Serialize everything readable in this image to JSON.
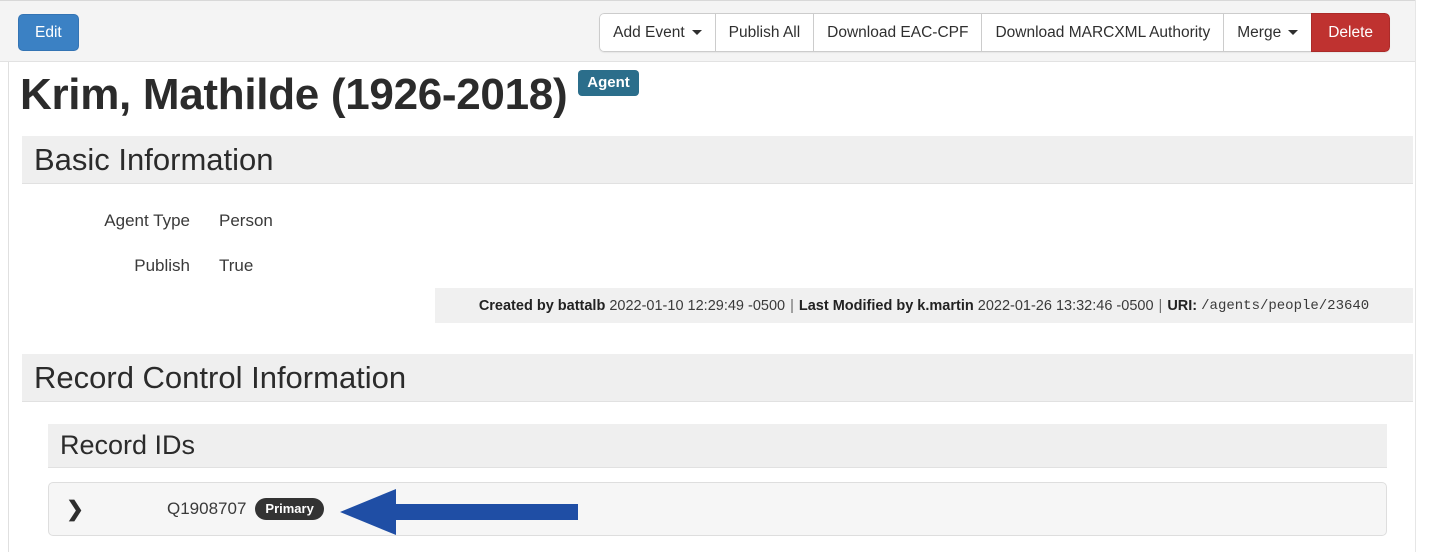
{
  "toolbar": {
    "edit_label": "Edit",
    "buttons": [
      {
        "label": "Add Event",
        "caret": true,
        "style": "default"
      },
      {
        "label": "Publish All",
        "caret": false,
        "style": "default"
      },
      {
        "label": "Download EAC-CPF",
        "caret": false,
        "style": "default"
      },
      {
        "label": "Download MARCXML Authority",
        "caret": false,
        "style": "default"
      },
      {
        "label": "Merge",
        "caret": true,
        "style": "default"
      },
      {
        "label": "Delete",
        "caret": false,
        "style": "danger"
      }
    ]
  },
  "header": {
    "title": "Krim, Mathilde (1926-2018)",
    "badge": "Agent"
  },
  "sections": {
    "basic_information": {
      "title": "Basic Information",
      "fields": [
        {
          "label": "Agent Type",
          "value": "Person"
        },
        {
          "label": "Publish",
          "value": "True"
        }
      ]
    },
    "record_control_information": {
      "title": "Record Control Information",
      "record_ids": {
        "title": "Record IDs",
        "rows": [
          {
            "chevron": "❯",
            "id": "Q1908707",
            "badge": "Primary"
          }
        ]
      }
    }
  },
  "metadata": {
    "created_by_label": "Created by battalb",
    "created_timestamp": "2022-01-10 12:29:49 -0500",
    "last_modified_label": "Last Modified by k.martin",
    "last_modified_timestamp": "2022-01-26 13:32:46 -0500",
    "uri_label": "URI:",
    "uri_value": "/agents/people/23640",
    "separator": "|"
  },
  "annotation": {
    "type": "arrow",
    "direction": "left",
    "color": "#1f4ea5",
    "points_at": "Q1908707 Primary"
  },
  "colors": {
    "primary_button": "#3b81c4",
    "danger_button": "#bf3230",
    "agent_badge": "#2b6e8b",
    "primary_badge": "#333333",
    "section_bar": "#efefef",
    "toolbar_bg": "#f4f4f4",
    "annotation_arrow": "#1f4ea5"
  }
}
